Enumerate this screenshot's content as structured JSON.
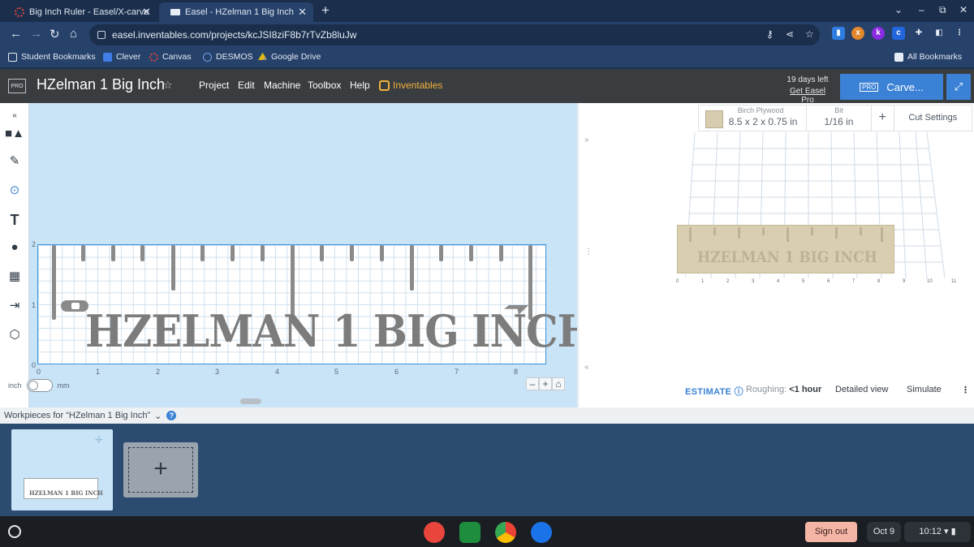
{
  "browser": {
    "tabs": [
      {
        "title": "Big Inch Ruler - Easel/X-carve"
      },
      {
        "title": "Easel - HZelman 1 Big Inch"
      }
    ],
    "url": "easel.inventables.com/projects/kcJSI8ziF8b7rTvZb8luJw",
    "bookmarks": [
      "Student Bookmarks",
      "Clever",
      "Canvas",
      "DESMOS",
      "Google Drive"
    ],
    "all_bookmarks": "All Bookmarks"
  },
  "easel": {
    "pro_badge": "PRO",
    "project_title": "HZelman 1 Big Inch",
    "menu": [
      "Project",
      "Edit",
      "Machine",
      "Toolbox",
      "Help"
    ],
    "inventables": "Inventables",
    "trial_days": "19 days left",
    "get_pro": "Get Easel Pro",
    "carve_label": "Carve...",
    "carve_pro": "PRO"
  },
  "design": {
    "carve_text": "HZELMAN 1 BIG INCH",
    "x_ticks": [
      "0",
      "1",
      "2",
      "3",
      "4",
      "5",
      "6",
      "7",
      "8"
    ],
    "y_ticks": [
      "0",
      "1",
      "2"
    ],
    "unit_left": "inch",
    "unit_right": "mm"
  },
  "material": {
    "label": "Birch Plywood",
    "size": "8.5 x 2 x 0.75 in",
    "bit_label": "Bit",
    "bit_value": "1/16 in",
    "cut_settings": "Cut Settings",
    "swatch_color": "#d7ccae"
  },
  "preview": {
    "estimate": "ESTIMATE",
    "roughing_label": "Roughing:",
    "roughing_value": "<1 hour",
    "detailed_view": "Detailed view",
    "simulate": "Simulate",
    "x_ticks": [
      "0",
      "1",
      "2",
      "3",
      "4",
      "5",
      "6",
      "7",
      "8",
      "9",
      "10",
      "11"
    ]
  },
  "workpieces": {
    "label": "Workpieces for “HZelman 1 Big Inch”",
    "thumb_text": "HZELMAN 1 BIG INCH"
  },
  "shelf": {
    "sign_out": "Sign out",
    "date": "Oct 9",
    "time": "10:12"
  }
}
